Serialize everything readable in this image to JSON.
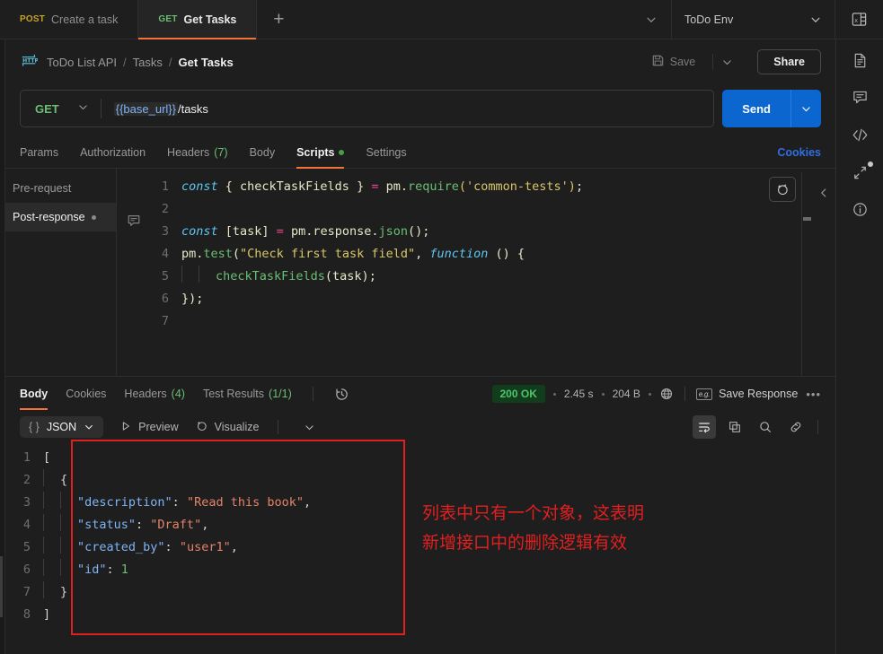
{
  "tabbar": {
    "tabs": [
      {
        "verb": "POST",
        "label": "Create a task",
        "active": false
      },
      {
        "verb": "GET",
        "label": "Get Tasks",
        "active": true
      }
    ],
    "new_tab_label": "+",
    "tabs_chevron": "chevron-down",
    "environment": {
      "name": "ToDo Env",
      "chevron": "chevron-down"
    },
    "env_icon_name": "environment-quick-look-icon"
  },
  "breadcrumb": {
    "icon": "http-protocol-icon",
    "items": [
      "ToDo List API",
      "Tasks",
      "Get Tasks"
    ],
    "separator": "/"
  },
  "header_actions": {
    "save_label": "Save",
    "save_icon": "floppy-disk-icon",
    "save_chevron": "chevron-down",
    "share_label": "Share",
    "docs_icon": "document-icon"
  },
  "request": {
    "method": "GET",
    "method_chevron": "chevron-down",
    "url_variable": "{{base_url}}",
    "url_path": "/tasks",
    "send_label": "Send",
    "send_chevron": "chevron-down"
  },
  "request_tabs": [
    {
      "label": "Params",
      "count": "",
      "active": false,
      "dot": false
    },
    {
      "label": "Authorization",
      "count": "",
      "active": false,
      "dot": false
    },
    {
      "label": "Headers",
      "count": "(7)",
      "active": false,
      "dot": false
    },
    {
      "label": "Body",
      "count": "",
      "active": false,
      "dot": false
    },
    {
      "label": "Scripts",
      "count": "",
      "active": true,
      "dot": true
    },
    {
      "label": "Settings",
      "count": "",
      "active": false,
      "dot": false
    }
  ],
  "cookies_link": "Cookies",
  "scripts": {
    "sidebar": [
      {
        "label": "Pre-request",
        "active": false,
        "dot": false
      },
      {
        "label": "Post-response",
        "active": true,
        "dot": true
      }
    ],
    "comment_icon": "comment-bubble-icon",
    "ai_icon": "ai-sparkle-icon",
    "collapse_icon": "chevron-left-icon",
    "line_numbers": [
      "1",
      "2",
      "3",
      "4",
      "5",
      "6",
      "7"
    ],
    "code_lines": [
      "const { checkTaskFields } = pm.require('common-tests');",
      "",
      "const [task] = pm.response.json();",
      "pm.test(\"Check first task field\", function () {",
      "    checkTaskFields(task);",
      "});",
      ""
    ],
    "tokens": {
      "l1": {
        "kw": "const",
        "bind": " { checkTaskFields } ",
        "op": "=",
        "obj": " pm.",
        "fn": "require",
        "arg": "('common-tests')",
        "end": ";"
      },
      "l3": {
        "kw": "const",
        "bind": " [task] ",
        "op": "=",
        "obj": " pm.response.",
        "fn": "json",
        "arg": "()",
        "end": ";"
      },
      "l4": {
        "obj": "pm.",
        "fn": "test",
        "open": "(",
        "str": "\"Check first task field\"",
        "comma": ", ",
        "kw": "function",
        "tail": " () {"
      },
      "l5": {
        "fn": "checkTaskFields",
        "arg": "(task)",
        "end": ";"
      },
      "l6": {
        "text": "});"
      }
    }
  },
  "response_tabs": [
    {
      "label": "Body",
      "count": "",
      "active": true
    },
    {
      "label": "Cookies",
      "count": "",
      "active": false
    },
    {
      "label": "Headers",
      "count": "(4)",
      "active": false
    },
    {
      "label": "Test Results",
      "count": "(1/1)",
      "active": false
    }
  ],
  "response_history_icon": "clock-history-icon",
  "response_meta": {
    "status": "200 OK",
    "time": "2.45 s",
    "size": "204 B",
    "globe_icon": "globe-icon",
    "save_response_label": "Save Response",
    "save_response_icon": "eg-example-icon",
    "more_label": "•••"
  },
  "body_toolbar": {
    "format_label": "JSON",
    "format_braces": "{ }",
    "format_chevron": "chevron-down",
    "preview_label": "Preview",
    "preview_icon": "play-triangle-icon",
    "visualize_label": "Visualize",
    "visualize_icon": "ai-sparkle-icon",
    "extra_chevron": "chevron-down",
    "icons": [
      {
        "name": "word-wrap-icon",
        "active": true
      },
      {
        "name": "copy-icon",
        "active": false
      },
      {
        "name": "search-icon",
        "active": false
      },
      {
        "name": "link-icon",
        "active": false
      }
    ]
  },
  "response_body": {
    "line_numbers": [
      "1",
      "2",
      "3",
      "4",
      "5",
      "6",
      "7",
      "8"
    ],
    "json_text": "[\n  {\n    \"description\": \"Read this book\",\n    \"status\": \"Draft\",\n    \"created_by\": \"user1\",\n    \"id\": 1\n  }\n]",
    "entries": [
      {
        "key": "\"description\"",
        "value": "\"Read this book\"",
        "type": "string",
        "comma": ","
      },
      {
        "key": "\"status\"",
        "value": "\"Draft\"",
        "type": "string",
        "comma": ","
      },
      {
        "key": "\"created_by\"",
        "value": "\"user1\"",
        "type": "string",
        "comma": ","
      },
      {
        "key": "\"id\"",
        "value": "1",
        "type": "number",
        "comma": ""
      }
    ],
    "open_bracket": "[",
    "open_brace": "{",
    "close_brace": "}",
    "close_bracket": "]"
  },
  "annotation": {
    "line1": "列表中只有一个对象，这表明",
    "line2": "新增接口中的删除逻辑有效",
    "color": "#e02020"
  },
  "right_rail": [
    {
      "name": "document-icon",
      "badge": false
    },
    {
      "name": "comment-icon",
      "badge": false
    },
    {
      "name": "code-icon",
      "badge": false
    },
    {
      "name": "resize-expand-icon",
      "badge": true
    },
    {
      "name": "info-icon",
      "badge": false
    }
  ],
  "colors": {
    "accent_orange": "#f2743a",
    "send_blue": "#0b66d0",
    "status_green": "#4fc46a",
    "link_blue": "#2f6fe4",
    "annotation_red": "#e02020",
    "background": "#1e1e1e"
  }
}
